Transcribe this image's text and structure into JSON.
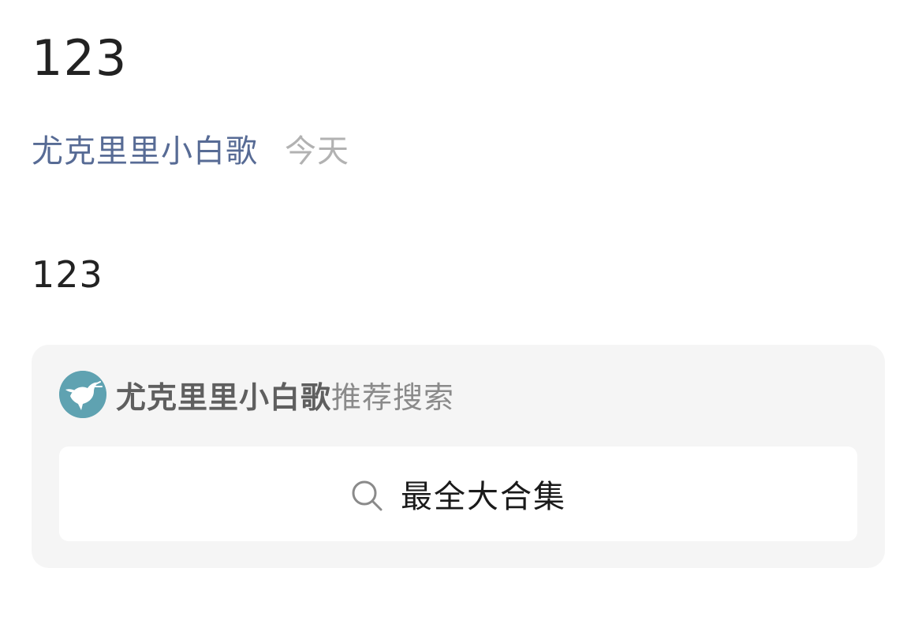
{
  "article": {
    "title": "123",
    "author": "尤克里里小白歌",
    "date": "今天",
    "body": "123"
  },
  "recommend_card": {
    "account_name": "尤克里里小白歌",
    "suffix": "推荐搜索",
    "avatar_icon": "dove-icon",
    "search_icon": "search-icon",
    "query": "最全大合集"
  },
  "colors": {
    "author_link": "#576b95",
    "date": "#b2b2b2",
    "card_background": "#f5f5f5",
    "avatar_background": "#5fa2b1"
  }
}
